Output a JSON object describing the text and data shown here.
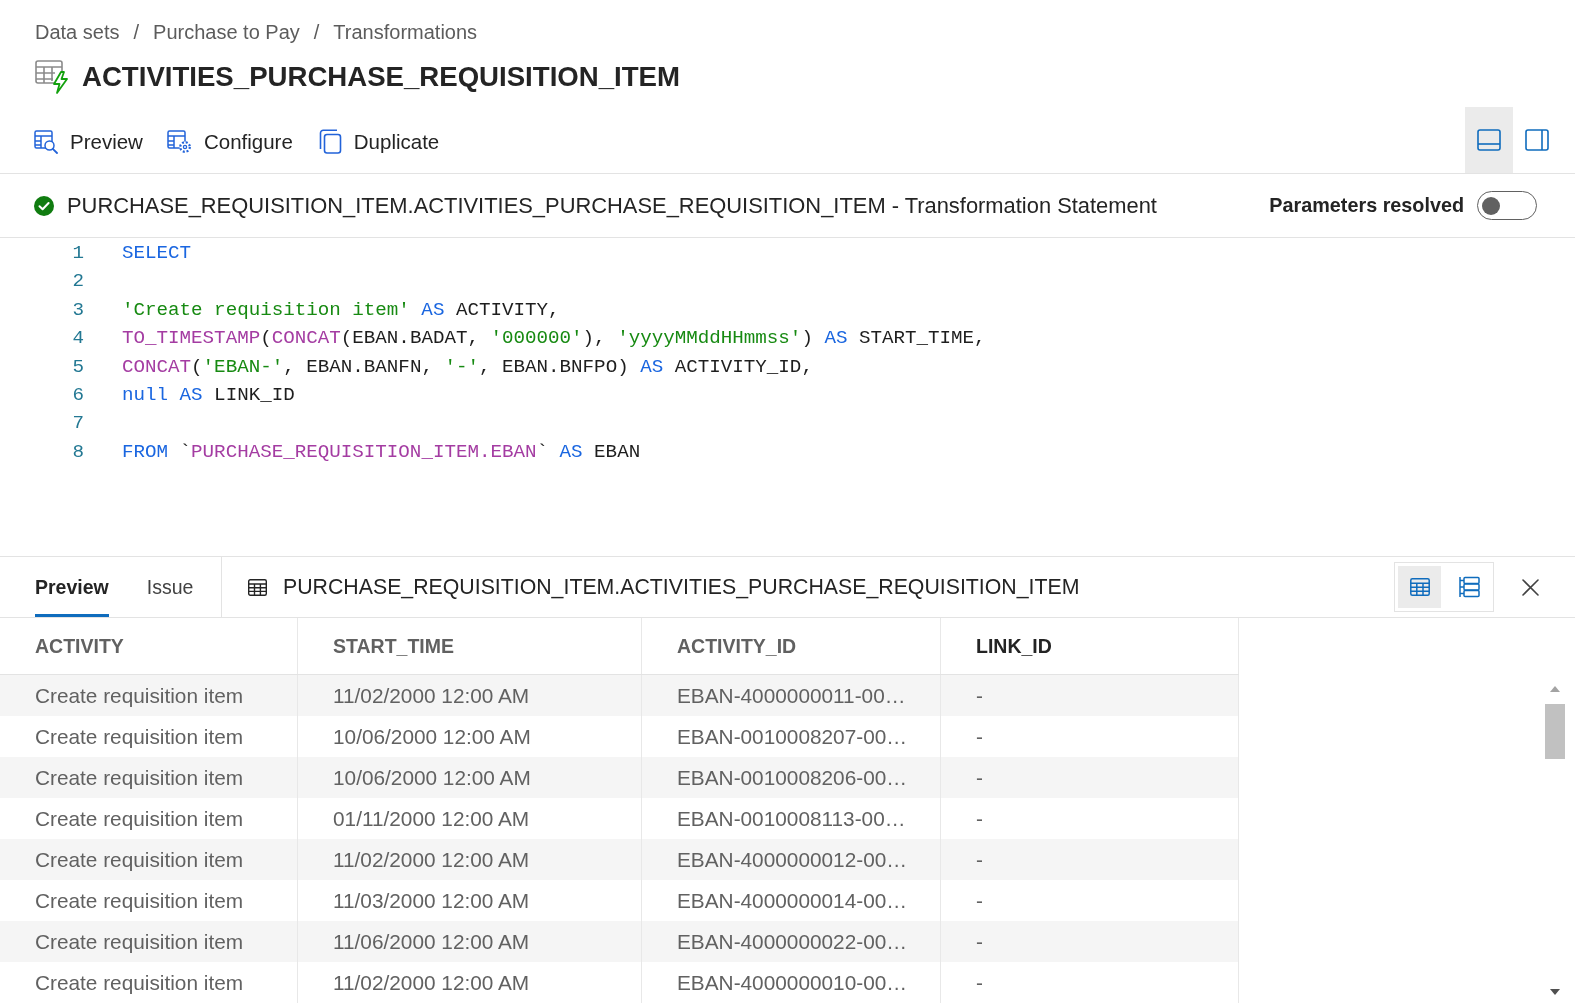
{
  "breadcrumb": [
    {
      "label": "Data sets",
      "separator": "/"
    },
    {
      "label": "Purchase to Pay",
      "separator": "/"
    },
    {
      "label": "Transformations"
    }
  ],
  "title": {
    "text": "ACTIVITIES_PURCHASE_REQUISITION_ITEM"
  },
  "toolbar": {
    "actions": [
      {
        "kind": "preview",
        "label": "Preview"
      },
      {
        "kind": "configure",
        "label": "Configure"
      },
      {
        "kind": "duplicate",
        "label": "Duplicate"
      }
    ],
    "layout_options": [
      {
        "kind": "bottom-panel",
        "selected": true
      },
      {
        "kind": "side-panel",
        "selected": false
      }
    ]
  },
  "statement": {
    "valid": true,
    "title": "PURCHASE_REQUISITION_ITEM.ACTIVITIES_PURCHASE_REQUISITION_ITEM - Transformation Statement",
    "parameters_resolved": {
      "label": "Parameters resolved",
      "on": false
    }
  },
  "editor": {
    "lines": [
      {
        "number": "1",
        "tokens": [
          {
            "kind": "keyword",
            "text": "SELECT"
          }
        ]
      },
      {
        "number": "2"
      },
      {
        "number": "3",
        "tokens": [
          {
            "kind": "string",
            "text": "'Create requisition item'"
          },
          {
            "kind": "keyword",
            "text": " AS"
          },
          {
            "kind": "text",
            "text": " ACTIVITY,"
          }
        ]
      },
      {
        "number": "4",
        "tokens": [
          {
            "kind": "function",
            "text": "TO_TIMESTAMP"
          },
          {
            "kind": "text",
            "text": "("
          },
          {
            "kind": "function",
            "text": "CONCAT"
          },
          {
            "kind": "text",
            "text": "(EBAN.BADAT, "
          },
          {
            "kind": "string",
            "text": "'000000'"
          },
          {
            "kind": "text",
            "text": "), "
          },
          {
            "kind": "string",
            "text": "'yyyyMMddHHmmss'"
          },
          {
            "kind": "text",
            "text": ") "
          },
          {
            "kind": "keyword",
            "text": "AS"
          },
          {
            "kind": "text",
            "text": " START_TIME,"
          }
        ]
      },
      {
        "number": "5",
        "tokens": [
          {
            "kind": "function",
            "text": "CONCAT"
          },
          {
            "kind": "text",
            "text": "("
          },
          {
            "kind": "string",
            "text": "'EBAN-'"
          },
          {
            "kind": "text",
            "text": ", EBAN.BANFN, "
          },
          {
            "kind": "string",
            "text": "'-'"
          },
          {
            "kind": "text",
            "text": ", EBAN.BNFPO) "
          },
          {
            "kind": "keyword",
            "text": "AS"
          },
          {
            "kind": "text",
            "text": " ACTIVITY_ID,"
          }
        ]
      },
      {
        "number": "6",
        "tokens": [
          {
            "kind": "keyword",
            "text": "null AS"
          },
          {
            "kind": "text",
            "text": " LINK_ID"
          }
        ]
      },
      {
        "number": "7"
      },
      {
        "number": "8",
        "tokens": [
          {
            "kind": "keyword",
            "text": "FROM"
          },
          {
            "kind": "text",
            "text": " `"
          },
          {
            "kind": "table",
            "text": "PURCHASE_REQUISITION_ITEM.EBAN"
          },
          {
            "kind": "text",
            "text": "` "
          },
          {
            "kind": "keyword",
            "text": "AS"
          },
          {
            "kind": "text",
            "text": " EBAN"
          }
        ]
      }
    ]
  },
  "results": {
    "tabs": [
      {
        "label": "Preview",
        "selected": true
      },
      {
        "label": "Issue",
        "selected": false
      }
    ],
    "table_name": "PURCHASE_REQUISITION_ITEM.ACTIVITIES_PURCHASE_REQUISITION_ITEM",
    "view_options": [
      {
        "kind": "grid",
        "selected": true
      },
      {
        "kind": "list",
        "selected": false
      }
    ],
    "table": {
      "columns": [
        {
          "label": "ACTIVITY",
          "highlighted": false
        },
        {
          "label": "START_TIME",
          "highlighted": false
        },
        {
          "label": "ACTIVITY_ID",
          "highlighted": false
        },
        {
          "label": "LINK_ID",
          "highlighted": true
        }
      ],
      "rows": [
        [
          "Create requisition item",
          "11/02/2000 12:00 AM",
          "EBAN-4000000011-00…",
          "-"
        ],
        [
          "Create requisition item",
          "10/06/2000 12:00 AM",
          "EBAN-0010008207-00…",
          "-"
        ],
        [
          "Create requisition item",
          "10/06/2000 12:00 AM",
          "EBAN-0010008206-00…",
          "-"
        ],
        [
          "Create requisition item",
          "01/11/2000 12:00 AM",
          "EBAN-0010008113-00…",
          "-"
        ],
        [
          "Create requisition item",
          "11/02/2000 12:00 AM",
          "EBAN-4000000012-00…",
          "-"
        ],
        [
          "Create requisition item",
          "11/03/2000 12:00 AM",
          "EBAN-4000000014-00…",
          "-"
        ],
        [
          "Create requisition item",
          "11/06/2000 12:00 AM",
          "EBAN-4000000022-00…",
          "-"
        ],
        [
          "Create requisition item",
          "11/02/2000 12:00 AM",
          "EBAN-4000000010-00…",
          "-"
        ]
      ]
    }
  }
}
